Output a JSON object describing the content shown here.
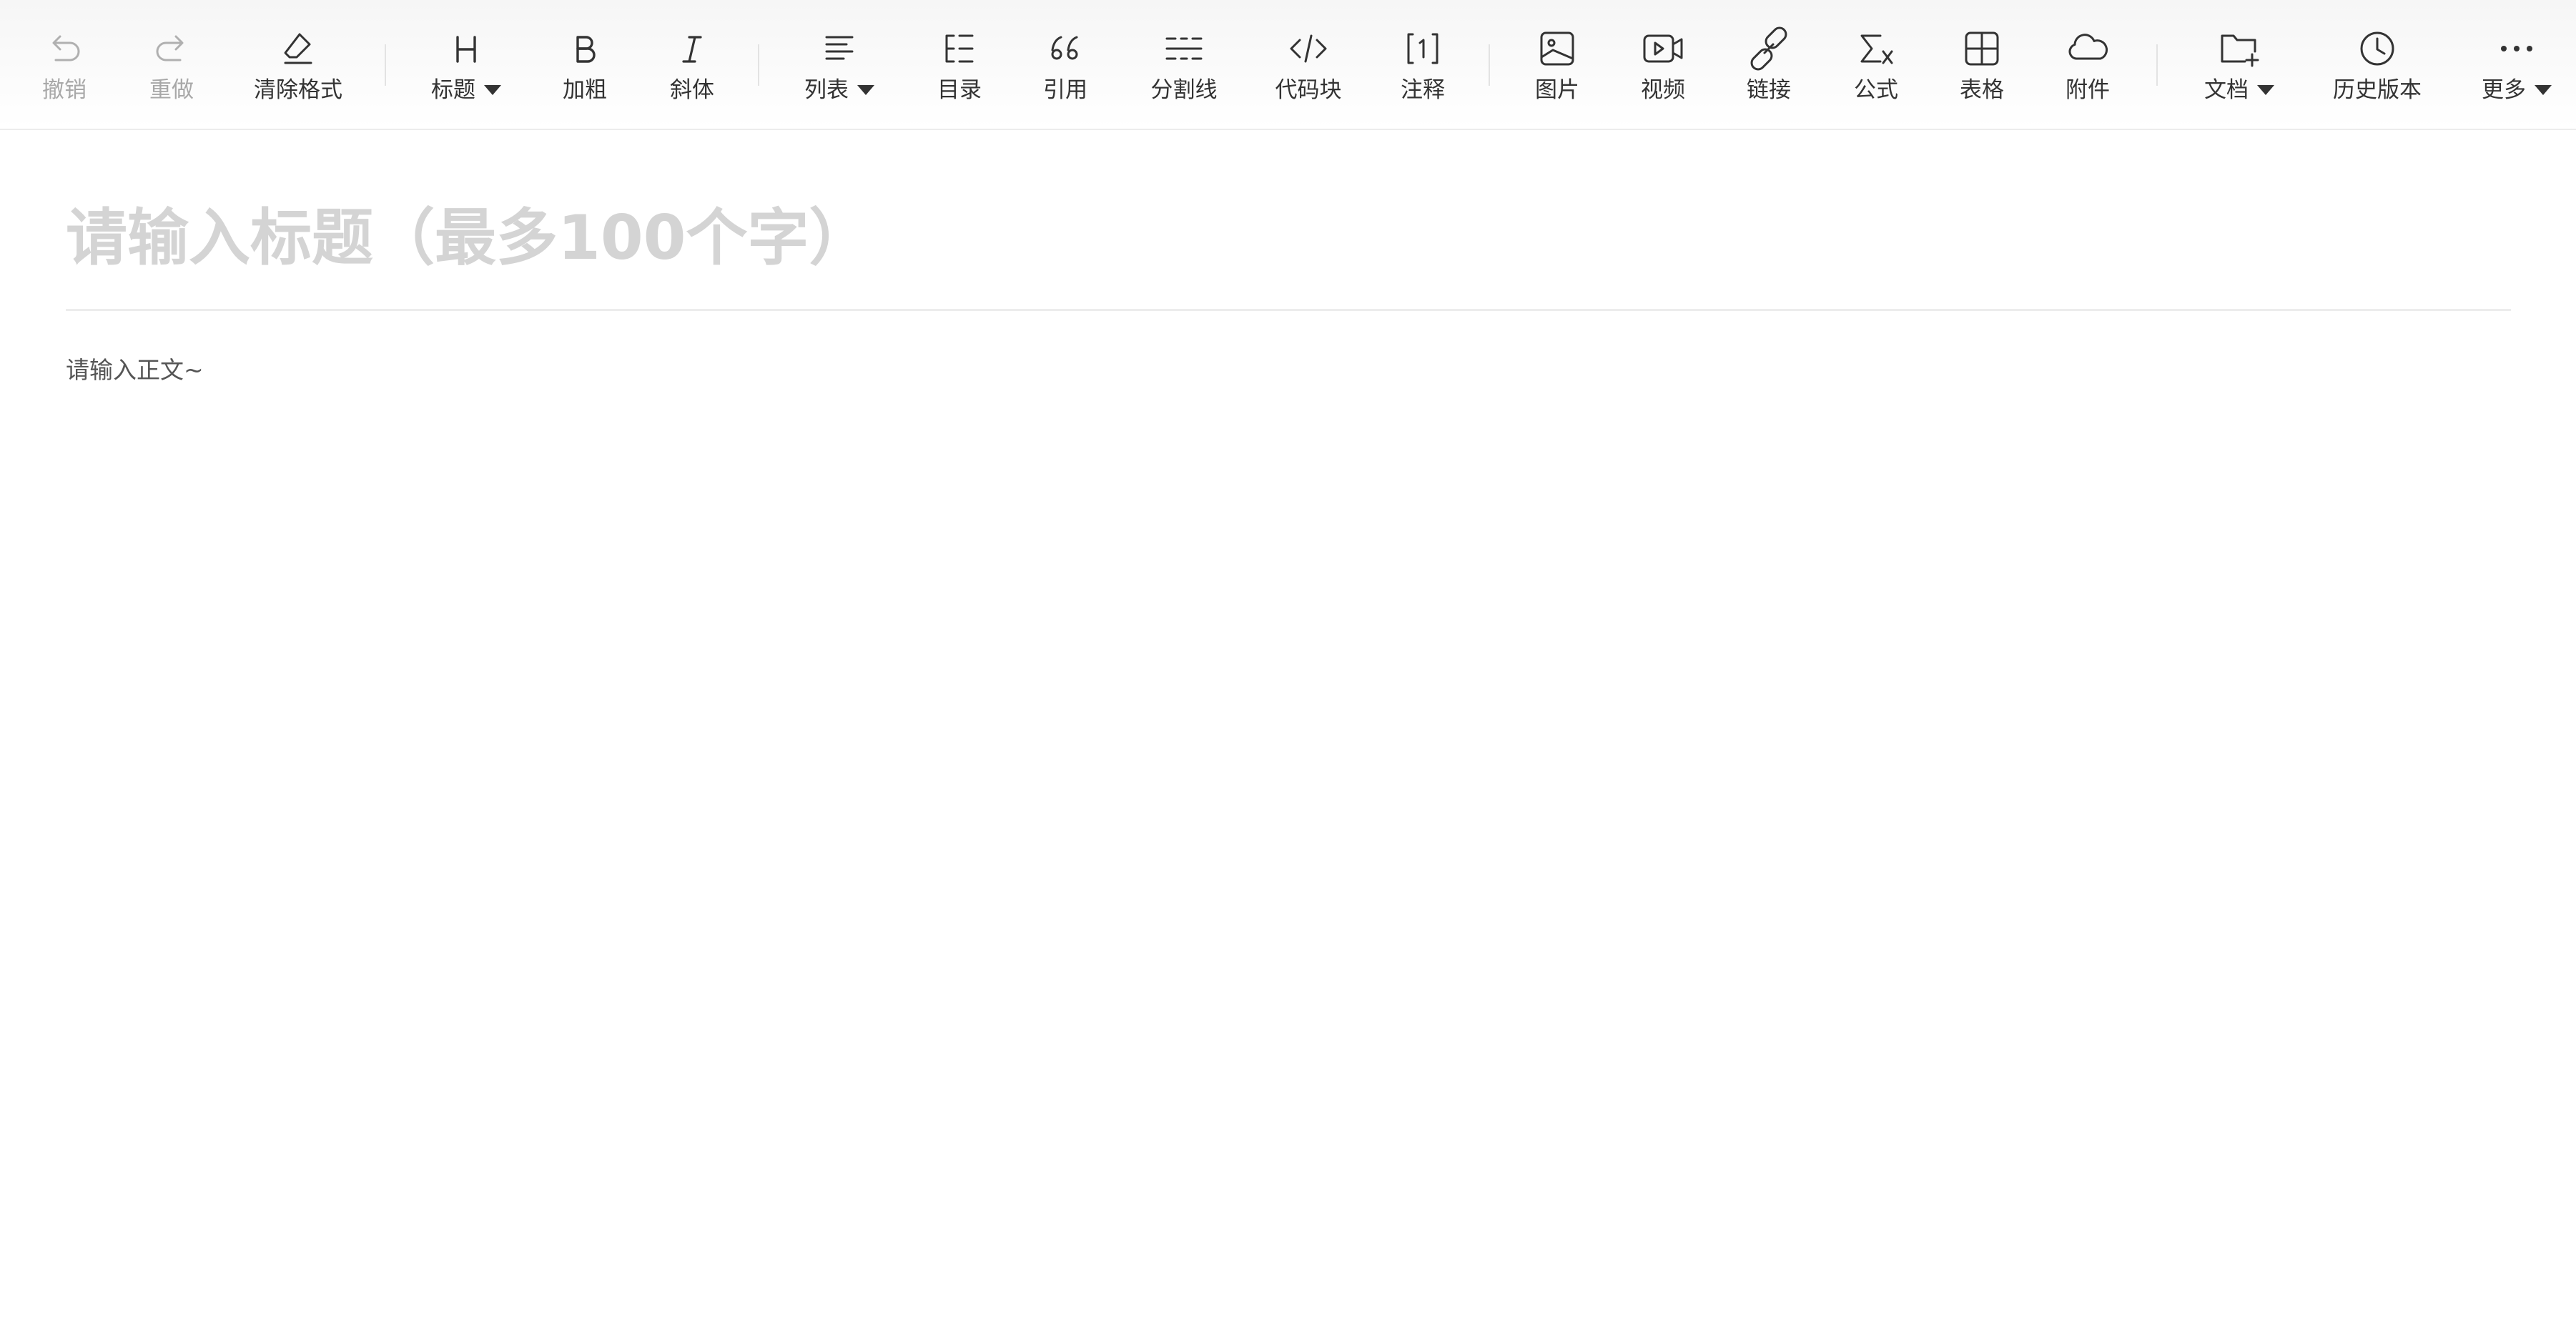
{
  "toolbar": {
    "undo": "撤销",
    "redo": "重做",
    "clear_format": "清除格式",
    "heading": "标题",
    "bold": "加粗",
    "italic": "斜体",
    "list": "列表",
    "toc": "目录",
    "quote": "引用",
    "divider": "分割线",
    "code_block": "代码块",
    "footnote": "注释",
    "image": "图片",
    "video": "视频",
    "link": "链接",
    "formula": "公式",
    "table": "表格",
    "attachment": "附件",
    "document": "文档",
    "history": "历史版本",
    "more": "更多"
  },
  "editor": {
    "title_placeholder": "请输入标题（最多100个字）",
    "body_placeholder": "请输入正文~"
  },
  "colors": {
    "text": "#333333",
    "disabled": "#a8a8a8",
    "placeholder": "#d4d4d4",
    "divider": "#ececec"
  }
}
